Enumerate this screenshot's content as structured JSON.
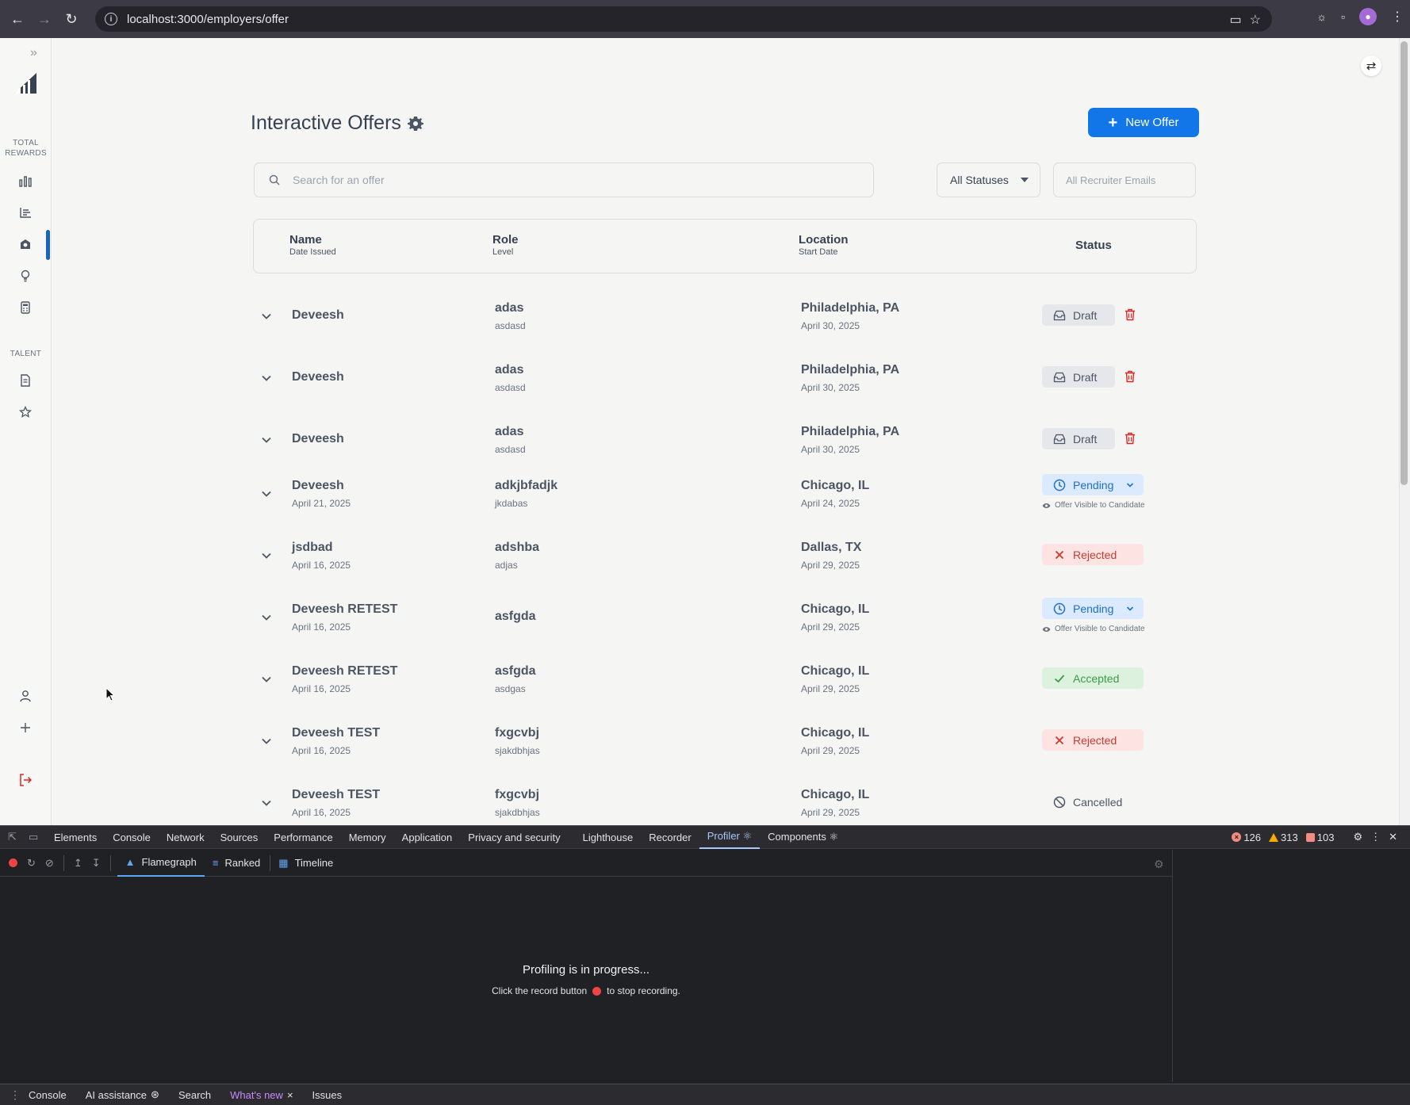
{
  "browser": {
    "url": "localhost:3000/employers/offer"
  },
  "rail": {
    "section_total_rewards": "TOTAL REWARDS",
    "section_talent": "TALENT"
  },
  "header": {
    "title": "Interactive Offers",
    "new_offer_label": "New Offer"
  },
  "filters": {
    "search_placeholder": "Search for an offer",
    "status_value": "All Statuses",
    "recruiter_placeholder": "All Recruiter Emails"
  },
  "table": {
    "headers": {
      "name": "Name",
      "date_issued": "Date Issued",
      "role": "Role",
      "level": "Level",
      "location": "Location",
      "start_date": "Start Date",
      "status": "Status"
    },
    "visible_note": "Offer Visible to Candidate",
    "rows": [
      {
        "name": "Deveesh",
        "date_issued": "",
        "role": "adas",
        "level": "asdasd",
        "location": "Philadelphia, PA",
        "start_date": "April 30, 2025",
        "status": "Draft"
      },
      {
        "name": "Deveesh",
        "date_issued": "",
        "role": "adas",
        "level": "asdasd",
        "location": "Philadelphia, PA",
        "start_date": "April 30, 2025",
        "status": "Draft"
      },
      {
        "name": "Deveesh",
        "date_issued": "",
        "role": "adas",
        "level": "asdasd",
        "location": "Philadelphia, PA",
        "start_date": "April 30, 2025",
        "status": "Draft"
      },
      {
        "name": "Deveesh",
        "date_issued": "April 21, 2025",
        "role": "adkjbfadjk",
        "level": "jkdabas",
        "location": "Chicago, IL",
        "start_date": "April 24, 2025",
        "status": "Pending"
      },
      {
        "name": "jsdbad",
        "date_issued": "April 16, 2025",
        "role": "adshba",
        "level": "adjas",
        "location": "Dallas, TX",
        "start_date": "April 29, 2025",
        "status": "Rejected"
      },
      {
        "name": "Deveesh RETEST",
        "date_issued": "April 16, 2025",
        "role": "asfgda",
        "level": "",
        "location": "Chicago, IL",
        "start_date": "April 29, 2025",
        "status": "Pending"
      },
      {
        "name": "Deveesh RETEST",
        "date_issued": "April 16, 2025",
        "role": "asfgda",
        "level": "asdgas",
        "location": "Chicago, IL",
        "start_date": "April 29, 2025",
        "status": "Accepted"
      },
      {
        "name": "Deveesh TEST",
        "date_issued": "April 16, 2025",
        "role": "fxgcvbj",
        "level": "sjakdbhjas",
        "location": "Chicago, IL",
        "start_date": "April 29, 2025",
        "status": "Rejected"
      },
      {
        "name": "Deveesh TEST",
        "date_issued": "April 16, 2025",
        "role": "fxgcvbj",
        "level": "sjakdbhjas",
        "location": "Chicago, IL",
        "start_date": "April 29, 2025",
        "status": "Cancelled"
      }
    ]
  },
  "devtools": {
    "tabs": [
      "Elements",
      "Console",
      "Network",
      "Sources",
      "Performance",
      "Memory",
      "Application",
      "Privacy and security",
      "Lighthouse",
      "Recorder",
      "Profiler ⚛",
      "Components ⚛"
    ],
    "active_tab": "Profiler ⚛",
    "errors": "126",
    "warnings": "313",
    "issues": "103",
    "profiler_tabs": [
      "Flamegraph",
      "Ranked",
      "Timeline"
    ],
    "progress_title": "Profiling is in progress...",
    "progress_sub_before": "Click the record button",
    "progress_sub_after": "to stop recording.",
    "drawer_tabs": [
      "Console",
      "AI assistance",
      "Search",
      "What's new",
      "Issues"
    ]
  },
  "colors": {
    "accent": "#1276e8",
    "draft_bg": "#e5e7eb",
    "pending": "#1d6fd0",
    "rejected": "#c53c30",
    "accepted": "#3b9b47"
  }
}
